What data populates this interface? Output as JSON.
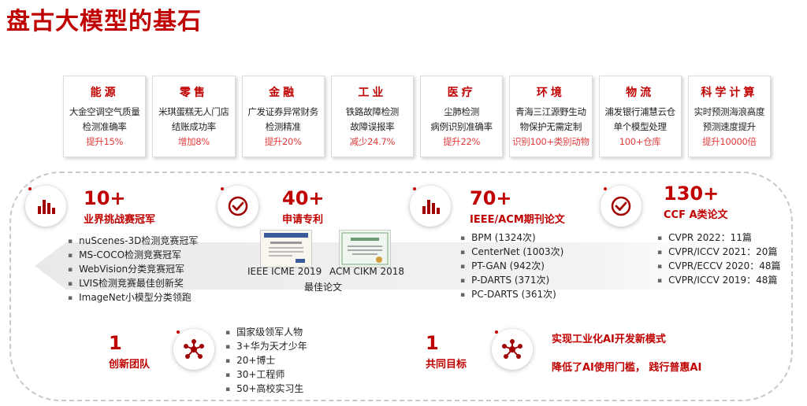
{
  "title": "盘古大模型的基石",
  "industries": [
    {
      "name": "能源",
      "desc1": "大金空调空气质量",
      "desc2": "检测准确率",
      "result": "提升15%"
    },
    {
      "name": "零售",
      "desc1": "米琪蛋糕无人门店",
      "desc2": "结账成功率",
      "result": "增加8%"
    },
    {
      "name": "金融",
      "desc1": "广发证券异常财务",
      "desc2": "检测精准",
      "result": "提升20%"
    },
    {
      "name": "工业",
      "desc1": "铁路故障检测",
      "desc2": "故障误报率",
      "result": "减少24.7%"
    },
    {
      "name": "医疗",
      "desc1": "尘肺检测",
      "desc2": "病例识别准确率",
      "result": "提升22%"
    },
    {
      "name": "环境",
      "desc1": "青海三江源野生动",
      "desc2": "物保护无需定制",
      "result": "识别100+类别动物"
    },
    {
      "name": "物流",
      "desc1": "浦发银行浦慧云仓",
      "desc2": "单个模型处理",
      "result": "100+仓库"
    },
    {
      "name": "科学计算",
      "desc1": "实时预测海浪高度",
      "desc2": "预测速度提升",
      "result": "提升10000倍"
    }
  ],
  "competitions": {
    "number": "10+",
    "label": "业界挑战赛冠军",
    "items": [
      "nuScenes-3D检测竞赛冠军",
      "MS-COCO检测竞赛冠军",
      "WebVision分类竞赛冠军",
      "LVIS检测竞赛最佳创新奖",
      "ImageNet小模型分类领跑"
    ]
  },
  "patents": {
    "number": "40+",
    "label": "申请专利",
    "paper1": "IEEE ICME 2019",
    "paper2": "ACM CIKM 2018",
    "paper_caption": "最佳论文"
  },
  "journals": {
    "number": "70+",
    "label": "IEEE/ACM期刊论文",
    "items": [
      "BPM (1324次)",
      "CenterNet (1003次)",
      "PT-GAN (942次)",
      "P-DARTS (371次)",
      "PC-DARTS (361次)"
    ]
  },
  "ccf": {
    "number": "130+",
    "label": "CCF A类论文",
    "items": [
      "CVPR 2022：11篇",
      "CVPR/ICCV 2021：20篇",
      "CVPR/ECCV 2020：48篇",
      "CVPR/ICCV 2019：48篇"
    ]
  },
  "team": {
    "number": "1",
    "label": "创新团队",
    "items": [
      "国家级领军人物",
      "3+华为天才少年",
      "20+博士",
      "30+工程师",
      "50+高校实习生"
    ]
  },
  "goal": {
    "number": "1",
    "label": "共同目标",
    "line1": "实现工业化AI开发新模式",
    "line2": "降低了AI使用门槛， 践行普惠AI"
  },
  "colors": {
    "accent": "#c00000",
    "result": "#e03c3c",
    "band": "#eeeeee"
  }
}
